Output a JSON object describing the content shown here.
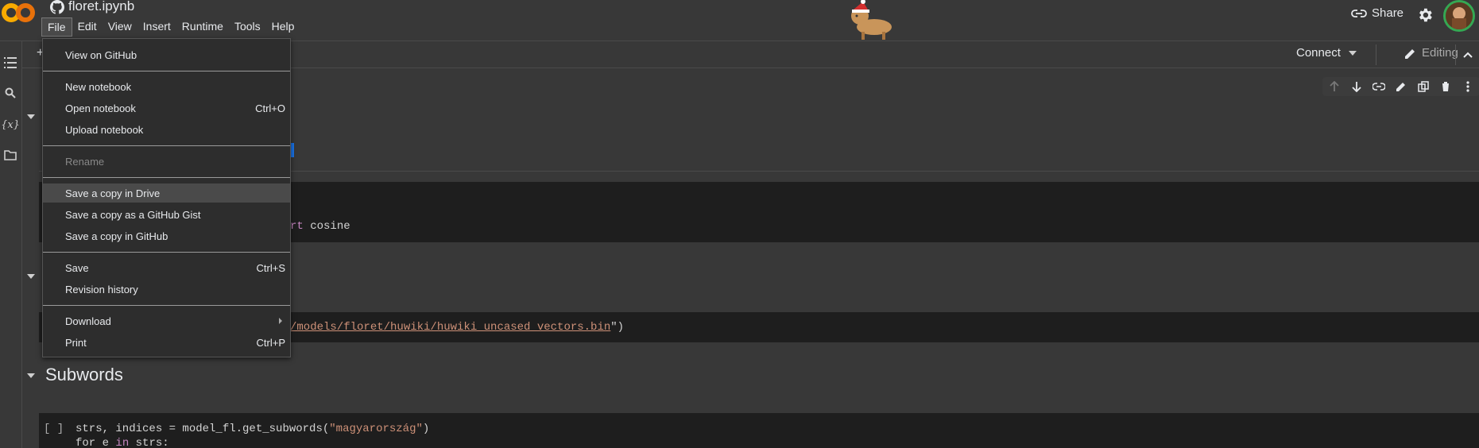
{
  "header": {
    "notebook_title": "floret.ipynb",
    "share_label": "Share",
    "menu": [
      "File",
      "Edit",
      "View",
      "Insert",
      "Runtime",
      "Tools",
      "Help"
    ]
  },
  "toolbar": {
    "add_label": "+",
    "connect_label": "Connect",
    "editing_label": "Editing"
  },
  "cells": {
    "code1_tail": "rt cosine",
    "code2_path": "/models/floret/huwiki/huwiki_uncased_vectors.bin",
    "code2_end": "\")",
    "subwords_heading": "Subwords",
    "code3_bracket": "[ ]",
    "code3_line1_a": "strs, indices = model_fl.get_subwords(",
    "code3_line1_str": "\"magyarország\"",
    "code3_line1_b": ")",
    "code3_line2_a": "for e ",
    "code3_line2_kw": "in",
    "code3_line2_b": " strs:"
  },
  "file_menu": {
    "view_on_github": "View on GitHub",
    "new_notebook": "New notebook",
    "open_notebook": "Open notebook",
    "open_notebook_shortcut": "Ctrl+O",
    "upload_notebook": "Upload notebook",
    "rename": "Rename",
    "save_copy_drive": "Save a copy in Drive",
    "save_copy_gist": "Save a copy as a GitHub Gist",
    "save_copy_github": "Save a copy in GitHub",
    "save": "Save",
    "save_shortcut": "Ctrl+S",
    "revision_history": "Revision history",
    "download": "Download",
    "print": "Print",
    "print_shortcut": "Ctrl+P"
  },
  "colors": {
    "background": "#383838",
    "menu_background": "#2d2d2d",
    "code_background": "#1e1e1e",
    "string": "#ce9178",
    "keyword": "#c586c0",
    "avatar_ring": "#34a853"
  }
}
